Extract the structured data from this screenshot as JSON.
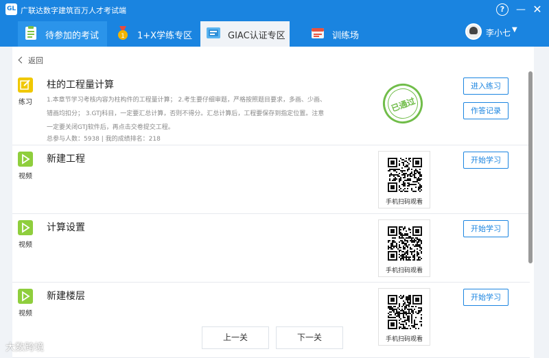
{
  "window": {
    "title": "广联达数字建筑百万人才考试端",
    "logo_text": "GL"
  },
  "nav": {
    "tabs": [
      {
        "label": "待参加的考试",
        "icon": "clipboard-icon",
        "active": false
      },
      {
        "label": "1+X学练专区",
        "icon": "medal-icon",
        "active": false
      },
      {
        "label": "GIAC认证专区",
        "icon": "certificate-icon",
        "active": true
      },
      {
        "label": "训练场",
        "icon": "training-icon",
        "active": false
      }
    ],
    "user_name": "李小七"
  },
  "back_label": "返回",
  "rows": [
    {
      "type_label": "练习",
      "title": "柱的工程量计算",
      "desc_lines": [
        "1.本章节学习考核内容为柱构件的工程量计算； 2.考生要仔细审题，严格按照题目要求，多画、少画、",
        "错画均扣分； 3.GTJ科目，一定要汇总计算，否则不得分。汇总计算后，工程要保存到指定位置。注意",
        "一定要关闭GTJ软件后，再点击交卷提交工程。"
      ],
      "stats": "总参与人数：5938 | 我的成绩排名：218",
      "stamp": "已通过",
      "buttons": [
        "进入练习",
        "作答记录"
      ]
    },
    {
      "type_label": "视频",
      "title": "新建工程",
      "qr_caption": "手机扫码观看",
      "button": "开始学习"
    },
    {
      "type_label": "视频",
      "title": "计算设置",
      "qr_caption": "手机扫码观看",
      "button": "开始学习"
    },
    {
      "type_label": "视频",
      "title": "新建楼层",
      "qr_caption": "手机扫码观看",
      "button": "开始学习"
    }
  ],
  "pager": {
    "prev": "上一关",
    "next": "下一关"
  },
  "watermark": "大数跨境",
  "colors": {
    "primary": "#1a84e0",
    "practice_icon": "#f0c800",
    "video_icon": "#8fce3d",
    "stamp": "#71bd4a"
  }
}
